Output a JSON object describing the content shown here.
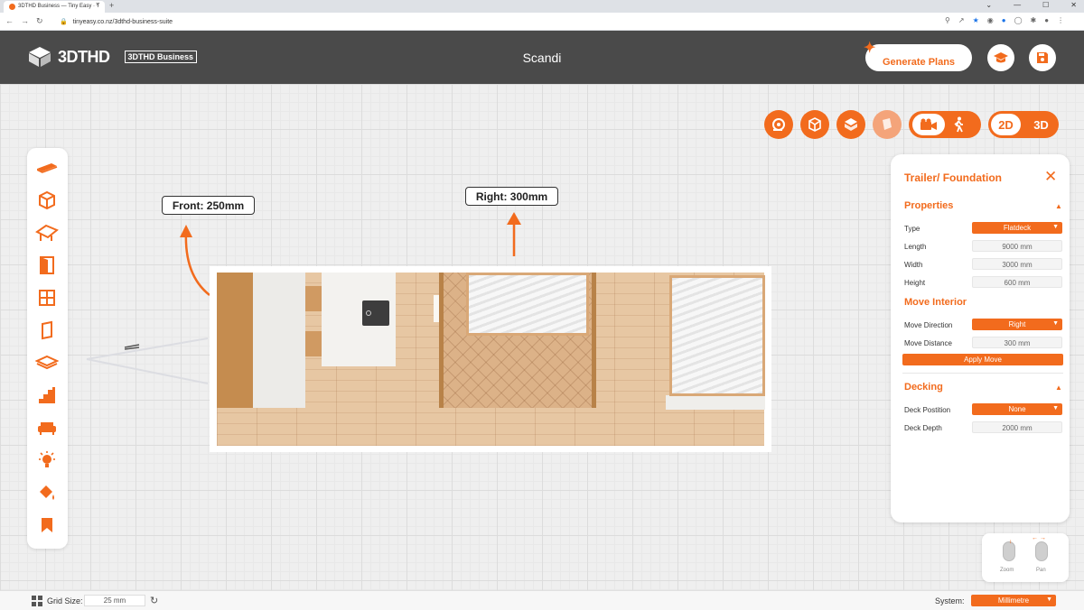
{
  "browser": {
    "tab_title": "3DTHD Business — Tiny Easy · T",
    "tab_close": "×",
    "new_tab": "+",
    "url": "tinyeasy.co.nz/3dthd-business-suite",
    "window_controls": [
      "⌄",
      "—",
      "☐",
      "✕"
    ]
  },
  "header": {
    "logo_text": "3DTHD",
    "business_badge": "3DTHD Business",
    "project_name": "Scandi",
    "generate_label": "Generate Plans",
    "icons": [
      "graduation-cap-icon",
      "save-icon"
    ]
  },
  "canvas": {
    "measure_front": "Front: 250mm",
    "measure_right": "Right: 300mm"
  },
  "view_toolbar": {
    "dim_2d": "2D",
    "dim_3d": "3D",
    "active_dim": "2D"
  },
  "left_toolbar": {
    "icons": [
      "trailer-icon",
      "cube-icon",
      "roof-icon",
      "door-icon",
      "window-icon",
      "wall-panel-icon",
      "floor-icon",
      "stairs-icon",
      "sofa-icon",
      "light-icon",
      "paint-icon",
      "bookmark-icon"
    ]
  },
  "panel": {
    "title": "Trailer/ Foundation",
    "properties_title": "Properties",
    "type_label": "Type",
    "type_value": "Flatdeck",
    "length_label": "Length",
    "length_value": "9000 mm",
    "width_label": "Width",
    "width_value": "3000 mm",
    "height_label": "Height",
    "height_value": "600 mm",
    "move_title": "Move Interior",
    "move_direction_label": "Move Direction",
    "move_direction_value": "Right",
    "move_distance_label": "Move Distance",
    "move_distance_value": "300 mm",
    "apply_label": "Apply Move",
    "decking_title": "Decking",
    "deck_position_label": "Deck Postition",
    "deck_position_value": "None",
    "deck_depth_label": "Deck Depth",
    "deck_depth_value": "2000 mm"
  },
  "zoom_pan": {
    "zoom_label": "Zoom",
    "pan_label": "Pan"
  },
  "status": {
    "grid_label": "Grid Size:",
    "grid_value": "25 mm",
    "system_label": "System:",
    "system_value": "Millimetre"
  },
  "colors": {
    "accent": "#f26b1d",
    "header_bg": "#4a4a4a"
  }
}
